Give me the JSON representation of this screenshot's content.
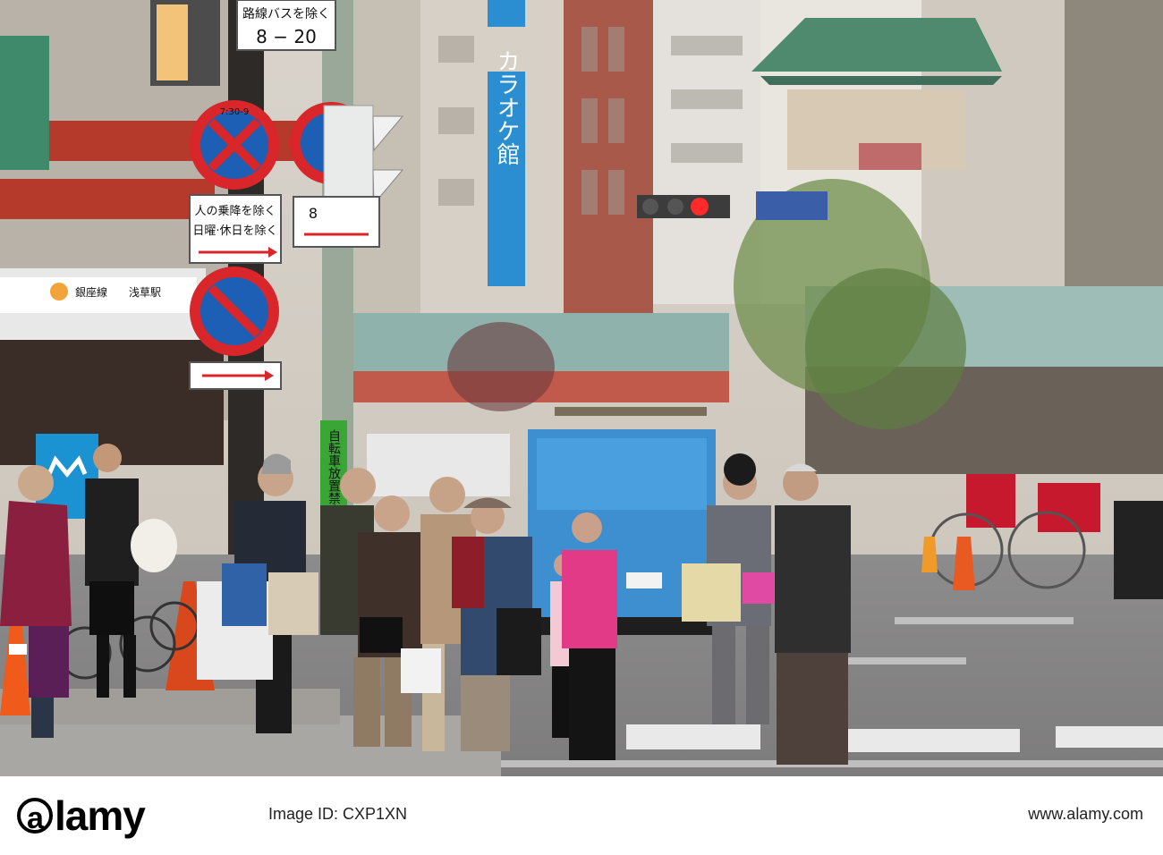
{
  "signs": {
    "top_plate_line1": "路線バスを除く",
    "top_plate_line2": "8 − 20",
    "no_stopping_time": "7:30-9",
    "plate_passengers": "人の乗降を除く",
    "plate_sundays": "日曜·休日を除く",
    "plate_eight": "8",
    "station_line": "銀座線",
    "station_name": "浅草駅",
    "karaoke_vertical": "カラオケ館",
    "banner_vertical": "自転車放置禁止"
  },
  "watermark": {
    "logo_text": "alamy",
    "image_id": "Image ID: CXP1XN",
    "url": "www.alamy.com"
  },
  "colors": {
    "sign_red": "#d8262a",
    "sign_blue": "#1c5fb4",
    "truck_blue": "#3d8fcf",
    "pink_jacket": "#e23a86"
  }
}
